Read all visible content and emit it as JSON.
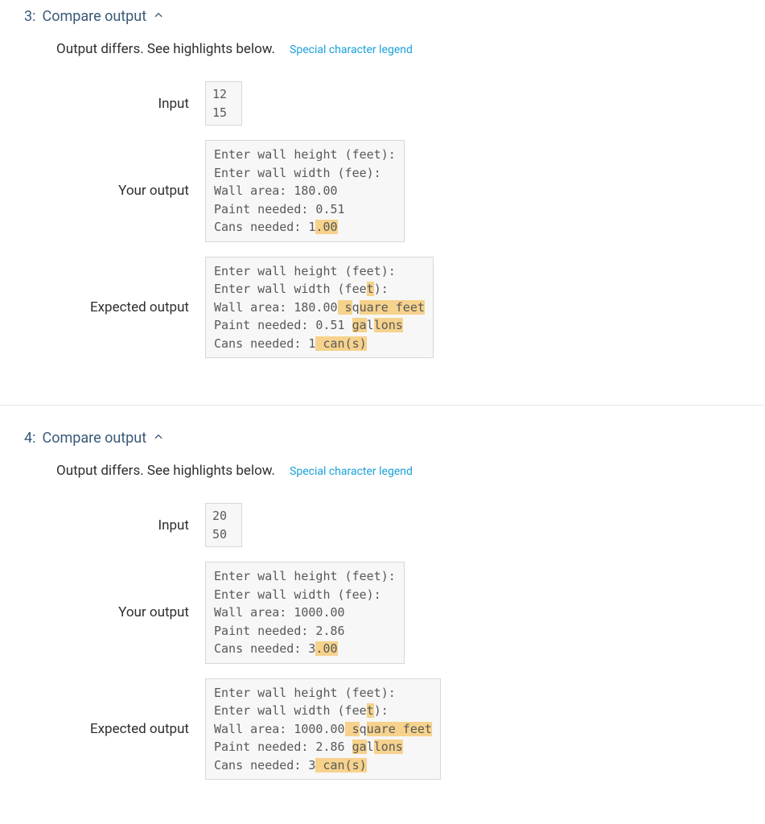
{
  "legend_link_text": "Special character legend",
  "summary_text": "Output differs. See highlights below.",
  "sections": [
    {
      "id": "3",
      "title_prefix": "3:",
      "title_text": "Compare output",
      "rows": {
        "input_label": "Input",
        "input_lines": [
          "12",
          "15"
        ],
        "your_label": "Your output",
        "your_lines": [
          [
            {
              "t": "Enter wall height (feet):"
            }
          ],
          [
            {
              "t": "Enter wall width (fee):"
            }
          ],
          [
            {
              "t": "Wall area: 180.00"
            }
          ],
          [
            {
              "t": "Paint needed: 0.51"
            }
          ],
          [
            {
              "t": "Cans needed: 1"
            },
            {
              "t": ".00",
              "hl": true
            }
          ]
        ],
        "expected_label": "Expected output",
        "expected_lines": [
          [
            {
              "t": "Enter wall height (feet):"
            }
          ],
          [
            {
              "t": "Enter wall width (fee"
            },
            {
              "t": "t",
              "hl": true
            },
            {
              "t": "):"
            }
          ],
          [
            {
              "t": "Wall area: 180.00"
            },
            {
              "t": " s",
              "hl": true
            },
            {
              "t": "q",
              "nohl": true
            },
            {
              "t": "uare feet",
              "hl": true
            }
          ],
          [
            {
              "t": "Paint needed: 0.51 "
            },
            {
              "t": "ga",
              "hl": true
            },
            {
              "t": "l",
              "nohl": true
            },
            {
              "t": "l",
              "hl": true
            },
            {
              "t": "ons",
              "hl": true
            }
          ],
          [
            {
              "t": "Cans needed: 1"
            },
            {
              "t": " ",
              "hl": true
            },
            {
              "t": "can",
              "hl": true
            },
            {
              "t": "(",
              "hl": true
            },
            {
              "t": "s)",
              "hl": true
            }
          ]
        ]
      }
    },
    {
      "id": "4",
      "title_prefix": "4:",
      "title_text": "Compare output",
      "rows": {
        "input_label": "Input",
        "input_lines": [
          "20",
          "50"
        ],
        "your_label": "Your output",
        "your_lines": [
          [
            {
              "t": "Enter wall height (feet):"
            }
          ],
          [
            {
              "t": "Enter wall width (fee):"
            }
          ],
          [
            {
              "t": "Wall area: 1000.00"
            }
          ],
          [
            {
              "t": "Paint needed: 2.86"
            }
          ],
          [
            {
              "t": "Cans needed: 3"
            },
            {
              "t": ".00",
              "hl": true
            }
          ]
        ],
        "expected_label": "Expected output",
        "expected_lines": [
          [
            {
              "t": "Enter wall height (feet):"
            }
          ],
          [
            {
              "t": "Enter wall width (fee"
            },
            {
              "t": "t",
              "hl": true
            },
            {
              "t": "):"
            }
          ],
          [
            {
              "t": "Wall area: 1000.00"
            },
            {
              "t": " s",
              "hl": true
            },
            {
              "t": "q",
              "nohl": true
            },
            {
              "t": "u",
              "hl": true
            },
            {
              "t": "are feet",
              "hl": true
            }
          ],
          [
            {
              "t": "Paint needed: 2.86 "
            },
            {
              "t": "ga",
              "hl": true
            },
            {
              "t": "l",
              "nohl": true
            },
            {
              "t": "l",
              "hl": true
            },
            {
              "t": "ons",
              "hl": true
            }
          ],
          [
            {
              "t": "Cans needed: 3"
            },
            {
              "t": " ",
              "hl": true
            },
            {
              "t": "can",
              "hl": true
            },
            {
              "t": "(",
              "hl": true
            },
            {
              "t": "s)",
              "hl": true
            }
          ]
        ]
      }
    }
  ]
}
